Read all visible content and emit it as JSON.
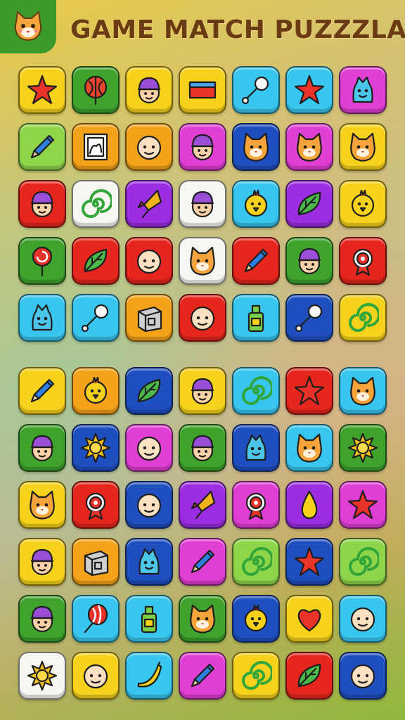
{
  "title": "GAME MATCH PUZZZLA!",
  "logo_icon": "cat-face-icon",
  "colors": {
    "yellow": "#f6d21c",
    "green": "#3fa22c",
    "lime": "#8fd54a",
    "orange": "#f4a21a",
    "red": "#e5261c",
    "magenta": "#e03fd4",
    "purple": "#9a2ee0",
    "blue": "#1f4fbf",
    "cyan": "#39c6ee",
    "white": "#f7f7f2"
  },
  "board_top": [
    [
      {
        "bg": "yellow",
        "icon": "star"
      },
      {
        "bg": "green",
        "icon": "tree"
      },
      {
        "bg": "yellow",
        "icon": "face-hat"
      },
      {
        "bg": "yellow",
        "icon": "block"
      },
      {
        "bg": "cyan",
        "icon": "rattle"
      },
      {
        "bg": "cyan",
        "icon": "star"
      },
      {
        "bg": "magenta",
        "icon": "monster"
      }
    ],
    [
      {
        "bg": "lime",
        "icon": "pencil"
      },
      {
        "bg": "orange",
        "icon": "frame"
      },
      {
        "bg": "orange",
        "icon": "face"
      },
      {
        "bg": "magenta",
        "icon": "face-hat"
      },
      {
        "bg": "blue",
        "icon": "cat"
      },
      {
        "bg": "magenta",
        "icon": "cat"
      },
      {
        "bg": "yellow",
        "icon": "cat"
      }
    ],
    [
      {
        "bg": "red",
        "icon": "face-hat"
      },
      {
        "bg": "white",
        "icon": "spiral"
      },
      {
        "bg": "purple",
        "icon": "kite"
      },
      {
        "bg": "white",
        "icon": "face-hat"
      },
      {
        "bg": "cyan",
        "icon": "chick"
      },
      {
        "bg": "purple",
        "icon": "leaf"
      },
      {
        "bg": "yellow",
        "icon": "chick"
      }
    ],
    [
      {
        "bg": "green",
        "icon": "lollipop"
      },
      {
        "bg": "red",
        "icon": "leaf"
      },
      {
        "bg": "red",
        "icon": "face"
      },
      {
        "bg": "white",
        "icon": "cat"
      },
      {
        "bg": "red",
        "icon": "pencil"
      },
      {
        "bg": "green",
        "icon": "face-hat"
      },
      {
        "bg": "red",
        "icon": "target"
      }
    ],
    [
      {
        "bg": "cyan",
        "icon": "monster"
      },
      {
        "bg": "cyan",
        "icon": "rattle"
      },
      {
        "bg": "orange",
        "icon": "box"
      },
      {
        "bg": "red",
        "icon": "face"
      },
      {
        "bg": "cyan",
        "icon": "bottle"
      },
      {
        "bg": "blue",
        "icon": "rattle"
      },
      {
        "bg": "yellow",
        "icon": "spiral"
      }
    ]
  ],
  "board_bottom": [
    [
      {
        "bg": "yellow",
        "icon": "pencil"
      },
      {
        "bg": "orange",
        "icon": "chick"
      },
      {
        "bg": "blue",
        "icon": "leaf"
      },
      {
        "bg": "yellow",
        "icon": "face-hat"
      },
      {
        "bg": "cyan",
        "icon": "spiral"
      },
      {
        "bg": "red",
        "icon": "star"
      },
      {
        "bg": "cyan",
        "icon": "cat"
      }
    ],
    [
      {
        "bg": "green",
        "icon": "face-hat"
      },
      {
        "bg": "blue",
        "icon": "sun"
      },
      {
        "bg": "magenta",
        "icon": "face"
      },
      {
        "bg": "green",
        "icon": "face-hat"
      },
      {
        "bg": "blue",
        "icon": "monster"
      },
      {
        "bg": "cyan",
        "icon": "cat"
      },
      {
        "bg": "green",
        "icon": "sun"
      }
    ],
    [
      {
        "bg": "yellow",
        "icon": "cat"
      },
      {
        "bg": "red",
        "icon": "target"
      },
      {
        "bg": "blue",
        "icon": "face"
      },
      {
        "bg": "purple",
        "icon": "kite"
      },
      {
        "bg": "magenta",
        "icon": "target"
      },
      {
        "bg": "purple",
        "icon": "drop"
      },
      {
        "bg": "magenta",
        "icon": "star"
      }
    ],
    [
      {
        "bg": "yellow",
        "icon": "face-hat"
      },
      {
        "bg": "orange",
        "icon": "box"
      },
      {
        "bg": "blue",
        "icon": "monster"
      },
      {
        "bg": "magenta",
        "icon": "pencil"
      },
      {
        "bg": "lime",
        "icon": "spiral"
      },
      {
        "bg": "blue",
        "icon": "star"
      },
      {
        "bg": "lime",
        "icon": "spiral"
      }
    ],
    [
      {
        "bg": "green",
        "icon": "face-hat"
      },
      {
        "bg": "cyan",
        "icon": "balloon"
      },
      {
        "bg": "cyan",
        "icon": "bottle"
      },
      {
        "bg": "green",
        "icon": "cat"
      },
      {
        "bg": "blue",
        "icon": "chick"
      },
      {
        "bg": "yellow",
        "icon": "heart"
      },
      {
        "bg": "cyan",
        "icon": "face"
      }
    ],
    [
      {
        "bg": "white",
        "icon": "sun"
      },
      {
        "bg": "yellow",
        "icon": "face"
      },
      {
        "bg": "cyan",
        "icon": "banana"
      },
      {
        "bg": "magenta",
        "icon": "pencil"
      },
      {
        "bg": "yellow",
        "icon": "spiral"
      },
      {
        "bg": "red",
        "icon": "leaf"
      },
      {
        "bg": "blue",
        "icon": "face"
      }
    ]
  ]
}
